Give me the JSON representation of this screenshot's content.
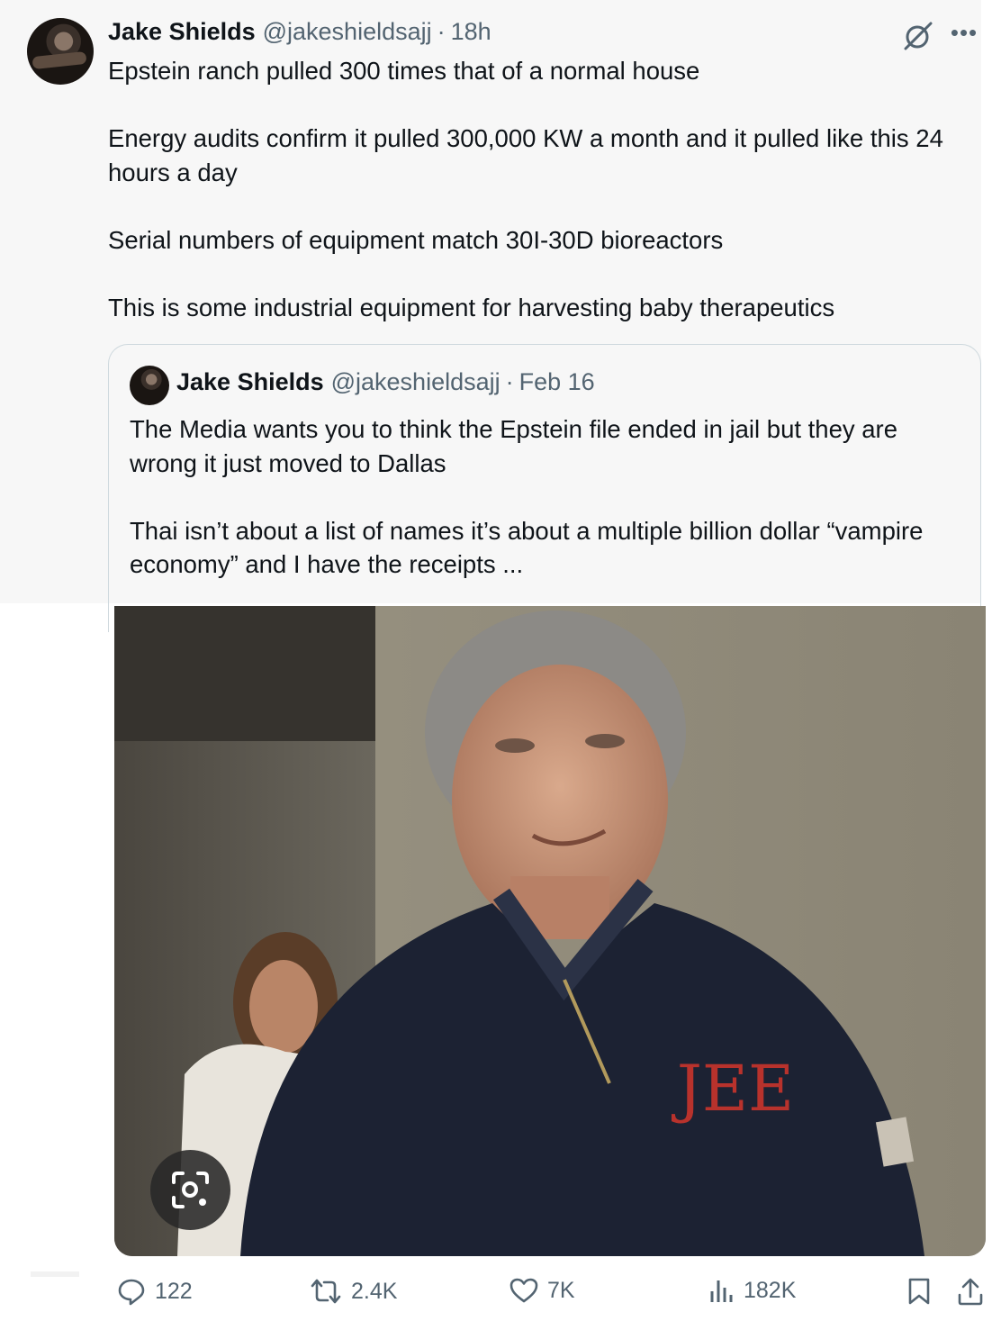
{
  "tweet": {
    "author_name": "Jake Shields",
    "author_handle": "@jakeshieldsajj",
    "separator": "·",
    "time": "18h",
    "paragraphs": [
      "Epstein ranch pulled 300 times that of a normal house",
      "Energy audits confirm it pulled 300,000 KW a month and it pulled like this 24 hours a day",
      "Serial numbers of equipment match 30I-30D bioreactors",
      "This is some industrial equipment for harvesting baby therapeutics"
    ]
  },
  "quoted_tweet": {
    "author_name": "Jake Shields",
    "author_handle": "@jakeshieldsajj",
    "separator": "·",
    "time": "Feb 16",
    "paragraphs": [
      "The Media wants you to think the Epstein file ended in jail but they are wrong it just moved to Dallas",
      "Thai isn’t about a list of names it’s about a multiple billion dollar “vampire economy” and I have the receipts ..."
    ]
  },
  "icons": {
    "grok": "grok-icon",
    "more": "more-options-icon",
    "lens": "lens-search-icon",
    "reply": "reply-icon",
    "retweet": "retweet-icon",
    "like": "like-icon",
    "views": "views-icon",
    "bookmark": "bookmark-icon",
    "share": "share-icon"
  },
  "actions": {
    "replies": "122",
    "reposts": "2.4K",
    "likes": "7K",
    "views": "182K"
  },
  "colors": {
    "text": "#0f1419",
    "secondary": "#536471",
    "border": "#cfd9de",
    "tweet_background": "#f7f7f7"
  }
}
